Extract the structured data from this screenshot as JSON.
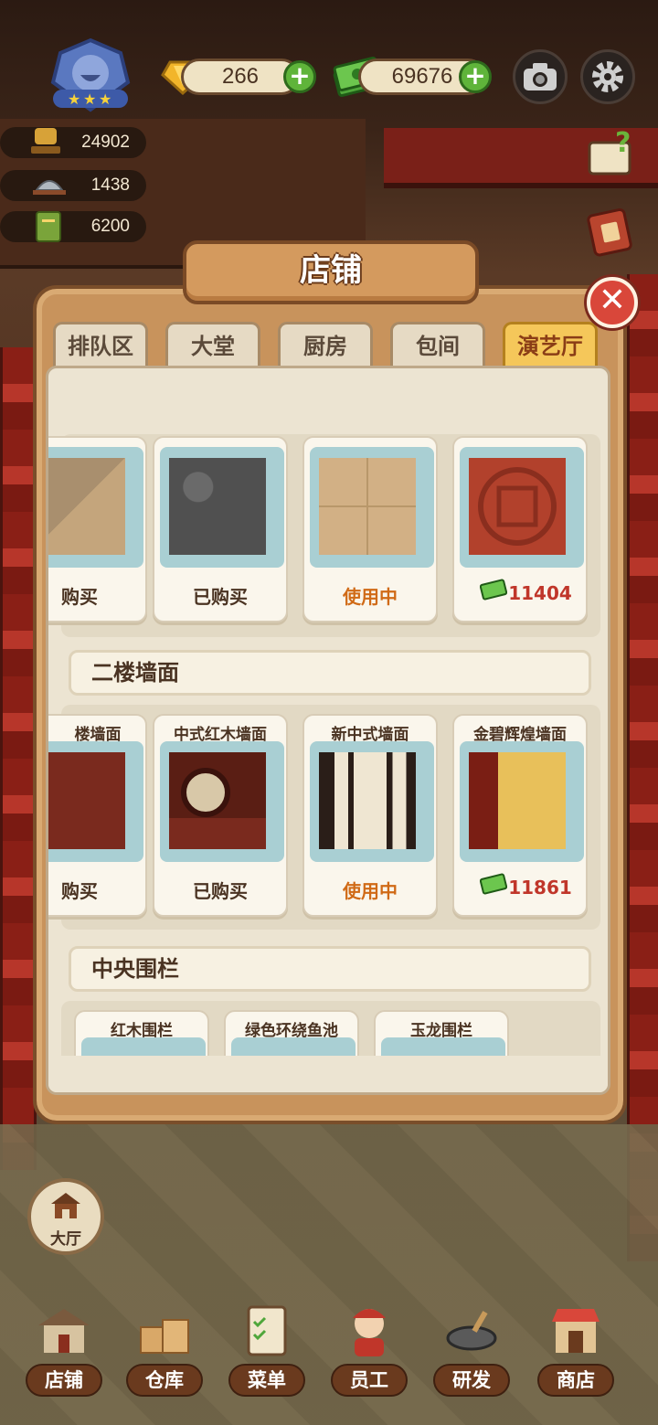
{
  "hud": {
    "gems": "266",
    "cash": "69676",
    "stats": [
      "24902",
      "1438",
      "6200"
    ]
  },
  "panel": {
    "title": "店铺",
    "tabs": [
      "排队区",
      "大堂",
      "厨房",
      "包间",
      "演艺厅"
    ],
    "active_tab": "演艺厅"
  },
  "sections": {
    "floor_row": {
      "items": [
        {
          "status": "购买",
          "type": "bought"
        },
        {
          "status": "已购买",
          "type": "bought"
        },
        {
          "status": "使用中",
          "type": "inuse"
        },
        {
          "price": "11404",
          "type": "price"
        }
      ]
    },
    "wall": {
      "title": "二楼墙面",
      "items": [
        {
          "name": "楼墙面",
          "status": "购买",
          "type": "bought"
        },
        {
          "name": "中式红木墙面",
          "status": "已购买",
          "type": "bought"
        },
        {
          "name": "新中式墙面",
          "status": "使用中",
          "type": "inuse"
        },
        {
          "name": "金碧辉煌墙面",
          "price": "11861",
          "type": "price"
        }
      ]
    },
    "fence": {
      "title": "中央围栏",
      "items": [
        {
          "name": "红木围栏"
        },
        {
          "name": "绿色环绕鱼池"
        },
        {
          "name": "玉龙围栏"
        }
      ]
    }
  },
  "hall_button": "大厅",
  "nav": [
    "店铺",
    "仓库",
    "菜单",
    "员工",
    "研发",
    "商店"
  ],
  "colors": {
    "accent_active_tab": "#f5c75a",
    "in_use": "#d06a16",
    "price": "#c0362a",
    "plus_button": "#5fb43a"
  }
}
